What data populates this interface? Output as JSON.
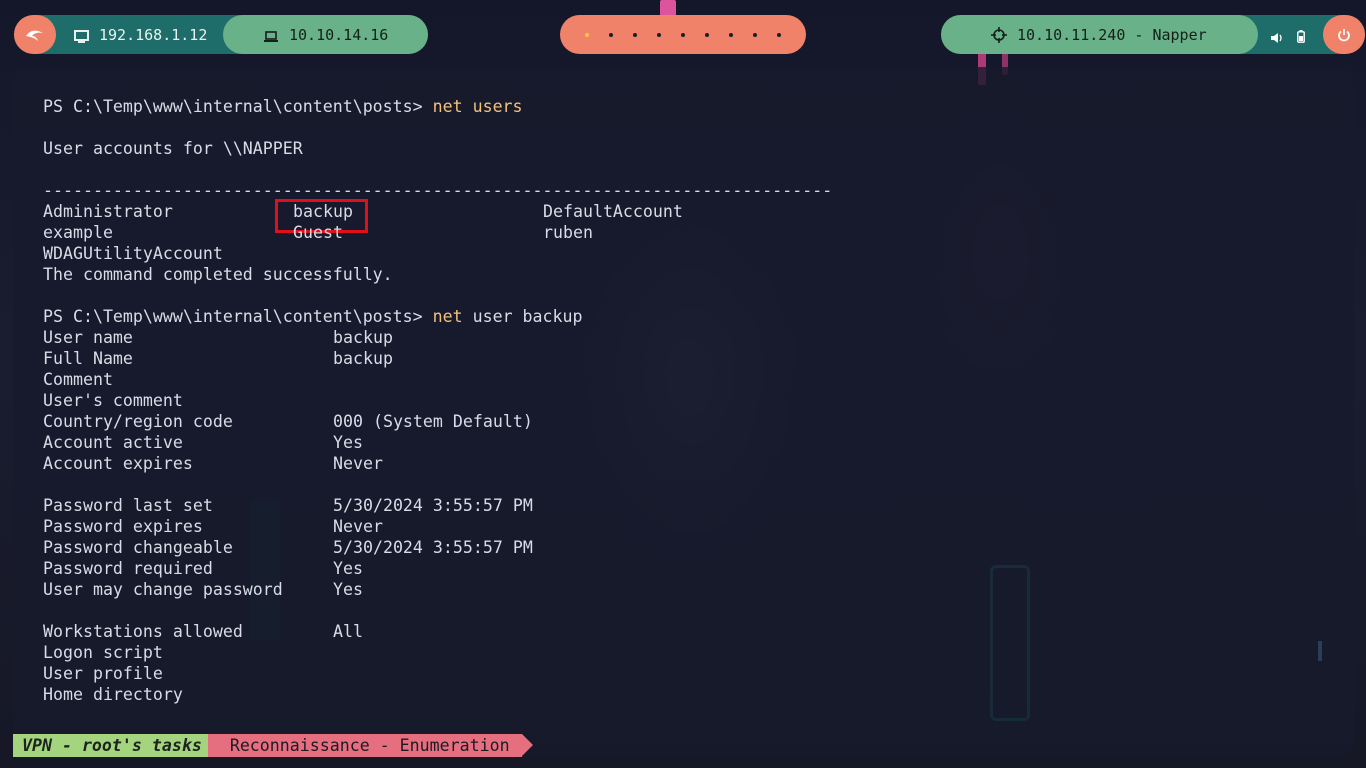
{
  "topbar": {
    "local_ip": "192.168.1.12",
    "vpn_ip": "10.10.14.16",
    "workspaces": {
      "count": 9,
      "active_index": 0
    },
    "target": "10.10.11.240 - Napper",
    "colors": {
      "teal_dark": "#1f6d6a",
      "green": "#69b189",
      "coral": "#f1826a",
      "active_dot": "#f5c84b"
    },
    "icons": [
      "kali-dragon-icon",
      "monitor-icon",
      "laptop-icon",
      "crosshair-icon",
      "volume-icon",
      "battery-icon",
      "power-icon"
    ]
  },
  "terminal": {
    "prompt": "PS C:\\Temp\\www\\internal\\content\\posts> ",
    "cmd1": "net users",
    "accounts_header": "User accounts for \\\\NAPPER",
    "separator": "-------------------------------------------------------------------------------",
    "users": [
      [
        "Administrator",
        "backup",
        "DefaultAccount"
      ],
      [
        "example",
        "Guest",
        "ruben"
      ],
      [
        "WDAGUtilityAccount",
        "",
        ""
      ]
    ],
    "completed": "The command completed successfully.",
    "cmd2_keyword": "net",
    "cmd2_rest": " user backup",
    "details": [
      {
        "label": "User name",
        "value": "backup"
      },
      {
        "label": "Full Name",
        "value": "backup"
      },
      {
        "label": "Comment",
        "value": ""
      },
      {
        "label": "User's comment",
        "value": ""
      },
      {
        "label": "Country/region code",
        "value": "000 (System Default)"
      },
      {
        "label": "Account active",
        "value": "Yes"
      },
      {
        "label": "Account expires",
        "value": "Never"
      },
      {
        "label": "",
        "value": ""
      },
      {
        "label": "Password last set",
        "value": "5/30/2024 3:55:57 PM"
      },
      {
        "label": "Password expires",
        "value": "Never"
      },
      {
        "label": "Password changeable",
        "value": "5/30/2024 3:55:57 PM"
      },
      {
        "label": "Password required",
        "value": "Yes"
      },
      {
        "label": "User may change password",
        "value": "Yes"
      },
      {
        "label": "",
        "value": ""
      },
      {
        "label": "Workstations allowed",
        "value": "All"
      },
      {
        "label": "Logon script",
        "value": ""
      },
      {
        "label": "User profile",
        "value": ""
      },
      {
        "label": "Home directory",
        "value": ""
      }
    ],
    "highlight_color": "#e0101a"
  },
  "statusline": {
    "session": "VPN - root's tasks",
    "window": "Reconnaissance - Enumeration"
  }
}
